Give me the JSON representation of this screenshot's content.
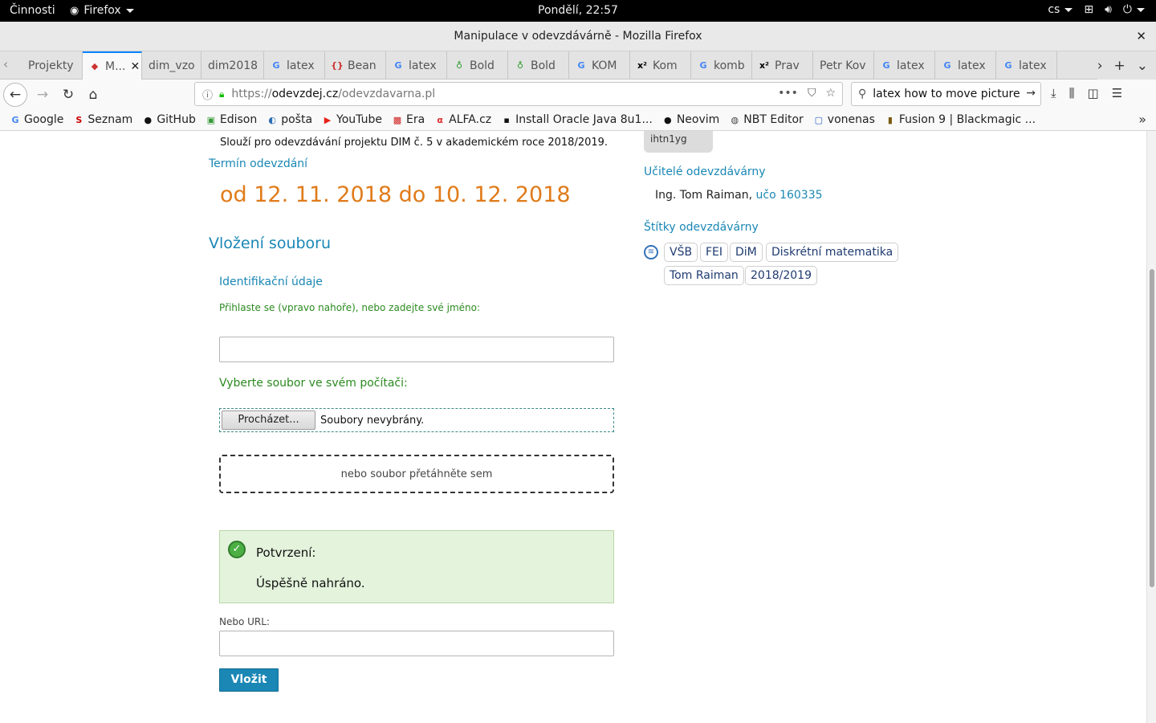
{
  "topbar": {
    "activities": "Činnosti",
    "app_name": "Firefox",
    "clock": "Pondělí, 22:57",
    "lang": "cs"
  },
  "window": {
    "title": "Manipulace v odevzdávárně - Mozilla Firefox"
  },
  "tabs": [
    {
      "title": "Projekty",
      "icon": "none"
    },
    {
      "title": "M...",
      "icon": "diamond-icon",
      "active": true
    },
    {
      "title": "dim_vzo",
      "icon": "none"
    },
    {
      "title": "dim2018",
      "icon": "none"
    },
    {
      "title": "latex",
      "icon": "google-icon"
    },
    {
      "title": "Bean",
      "icon": "braces-icon"
    },
    {
      "title": "latex",
      "icon": "google-icon"
    },
    {
      "title": "Bold",
      "icon": "overleaf-icon"
    },
    {
      "title": "Bold",
      "icon": "overleaf-icon"
    },
    {
      "title": "KOM",
      "icon": "google-icon"
    },
    {
      "title": "Kom",
      "icon": "x2-icon"
    },
    {
      "title": "komb",
      "icon": "google-icon"
    },
    {
      "title": "Prav",
      "icon": "x2-icon"
    },
    {
      "title": "Petr Kov",
      "icon": "none"
    },
    {
      "title": "latex",
      "icon": "google-icon"
    },
    {
      "title": "latex",
      "icon": "google-icon"
    },
    {
      "title": "latex",
      "icon": "google-icon"
    }
  ],
  "navbar": {
    "url_prefix": "https://",
    "url_domain": "odevzdej.cz",
    "url_path": "/odevzdavarna.pl",
    "search_query": "latex how to move picture"
  },
  "bookmarks": [
    {
      "label": "Google",
      "icon": "google-icon"
    },
    {
      "label": "Seznam",
      "icon": "seznam-icon"
    },
    {
      "label": "GitHub",
      "icon": "github-icon"
    },
    {
      "label": "Edison",
      "icon": "edison-icon"
    },
    {
      "label": "pošta",
      "icon": "mail-icon"
    },
    {
      "label": "YouTube",
      "icon": "youtube-icon"
    },
    {
      "label": "Era",
      "icon": "era-icon"
    },
    {
      "label": "ALFA.cz",
      "icon": "alfa-icon"
    },
    {
      "label": "Install Oracle Java 8u1...",
      "icon": "terminal-icon"
    },
    {
      "label": "Neovim",
      "icon": "github-icon"
    },
    {
      "label": "NBT Editor",
      "icon": "globe-icon"
    },
    {
      "label": "vonenas",
      "icon": "square-icon"
    },
    {
      "label": "Fusion 9 | Blackmagic ...",
      "icon": "fusion-icon"
    }
  ],
  "page": {
    "code": "ihtn1yg",
    "description": "Slouží pro odevzdávání projektu DIM č. 5 v akademickém roce 2018/2019.",
    "deadline_heading": "Termín odevzdání",
    "deadline": "od 12. 11. 2018 do 10. 12. 2018",
    "upload_heading": "Vložení souboru",
    "ident_heading": "Identifikační údaje",
    "login_hint": "Přihlaste se (vpravo nahoře), nebo zadejte své jméno:",
    "name_value": "",
    "file_label": "Vyberte soubor ve svém počítači:",
    "browse_button": "Procházet...",
    "no_files": "Soubory nevybrány.",
    "drop_hint": "nebo soubor přetáhněte sem",
    "confirm_title": "Potvrzení:",
    "confirm_message": "Úspěšně nahráno.",
    "url_label": "Nebo URL:",
    "url_value": "",
    "submit": "Vložit",
    "teachers_heading": "Učitelé odevzdávárny",
    "teacher_name": "Ing. Tom Raiman,",
    "teacher_uco": "učo 160335",
    "tags_heading": "Štítky odevzdávárny",
    "tags": [
      "VŠB",
      "FEI",
      "DiM",
      "Diskrétní matematika",
      "Tom Raiman",
      "2018/2019"
    ]
  },
  "colors": {
    "accent": "#1a87b5",
    "deadline": "#e07b1a",
    "hint_green": "#2b8a20",
    "confirm_bg": "#e4f3dc"
  }
}
